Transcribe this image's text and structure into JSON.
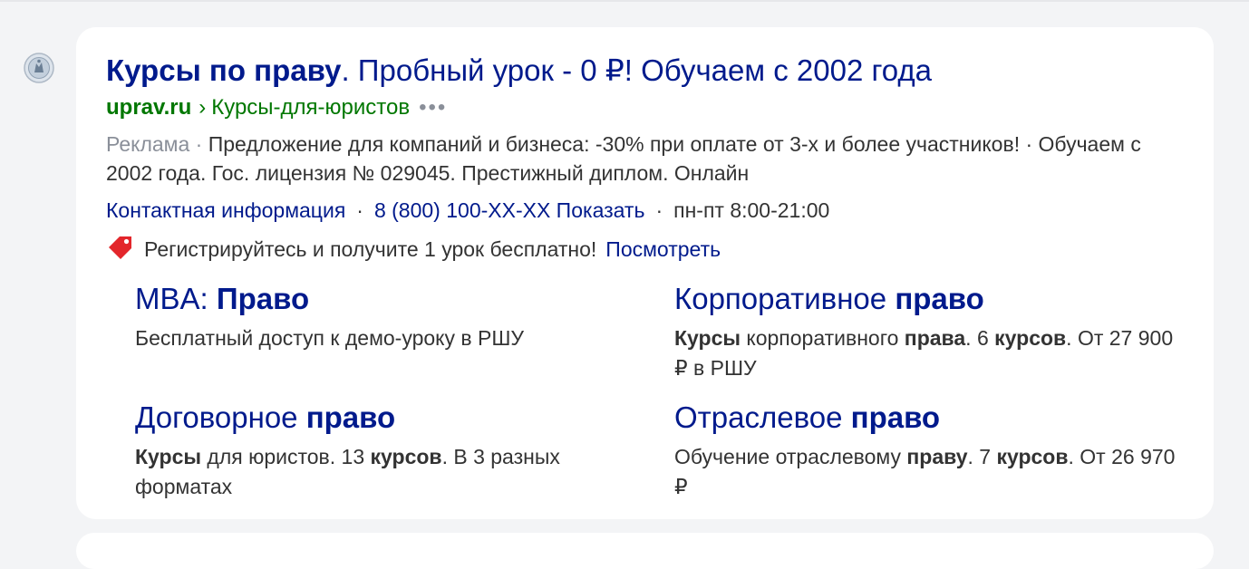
{
  "ad": {
    "title_bold": "Курсы по праву",
    "title_rest": ". Пробный урок - 0 ₽! Обучаем с 2002 года",
    "host": "uprav.ru",
    "breadcrumb_sep": "›",
    "path": "Курсы-для-юристов",
    "more_menu": "•••",
    "ad_label": "Реклама",
    "dot": "·",
    "description": "Предложение для компаний и бизнеса: -30% при оплате от 3-х и более участников! · Обучаем с 2002 года. Гос. лицензия № 029045. Престижный диплом. Онлайн",
    "contacts": {
      "contact_link": "Контактная информация",
      "phone_link": "8 (800) 100-XX-XX Показать",
      "hours": "пн-пт 8:00-21:00"
    },
    "promo": {
      "icon": "price-tag-icon",
      "text": "Регистрируйтесь и получите 1 урок бесплатно!",
      "link": "Посмотреть"
    },
    "sitelinks": [
      {
        "title": [
          {
            "t": "MBA: ",
            "b": false
          },
          {
            "t": "Право",
            "b": true
          }
        ],
        "desc": [
          {
            "t": "Бесплатный доступ к демо-уроку в РШУ",
            "b": false
          }
        ]
      },
      {
        "title": [
          {
            "t": "Корпоративное ",
            "b": false
          },
          {
            "t": "право",
            "b": true
          }
        ],
        "desc": [
          {
            "t": "Курсы",
            "b": true
          },
          {
            "t": " корпоративного ",
            "b": false
          },
          {
            "t": "права",
            "b": true
          },
          {
            "t": ". 6 ",
            "b": false
          },
          {
            "t": "курсов",
            "b": true
          },
          {
            "t": ". От 27 900 ₽ в РШУ",
            "b": false
          }
        ]
      },
      {
        "title": [
          {
            "t": "Договорное ",
            "b": false
          },
          {
            "t": "право",
            "b": true
          }
        ],
        "desc": [
          {
            "t": "Курсы",
            "b": true
          },
          {
            "t": " для юристов. 13 ",
            "b": false
          },
          {
            "t": "курсов",
            "b": true
          },
          {
            "t": ". В 3 разных форматах",
            "b": false
          }
        ]
      },
      {
        "title": [
          {
            "t": "Отраслевое ",
            "b": false
          },
          {
            "t": "право",
            "b": true
          }
        ],
        "desc": [
          {
            "t": "Обучение отраслевому ",
            "b": false
          },
          {
            "t": "праву",
            "b": true
          },
          {
            "t": ". 7 ",
            "b": false
          },
          {
            "t": "курсов",
            "b": true
          },
          {
            "t": ". От 26 970 ₽",
            "b": false
          }
        ]
      }
    ]
  },
  "colors": {
    "link": "#001a8c",
    "url_green": "#007700",
    "text": "#333333",
    "muted": "#8a8f99",
    "tag_red": "#e3262b",
    "page_bg": "#f3f4f6"
  }
}
